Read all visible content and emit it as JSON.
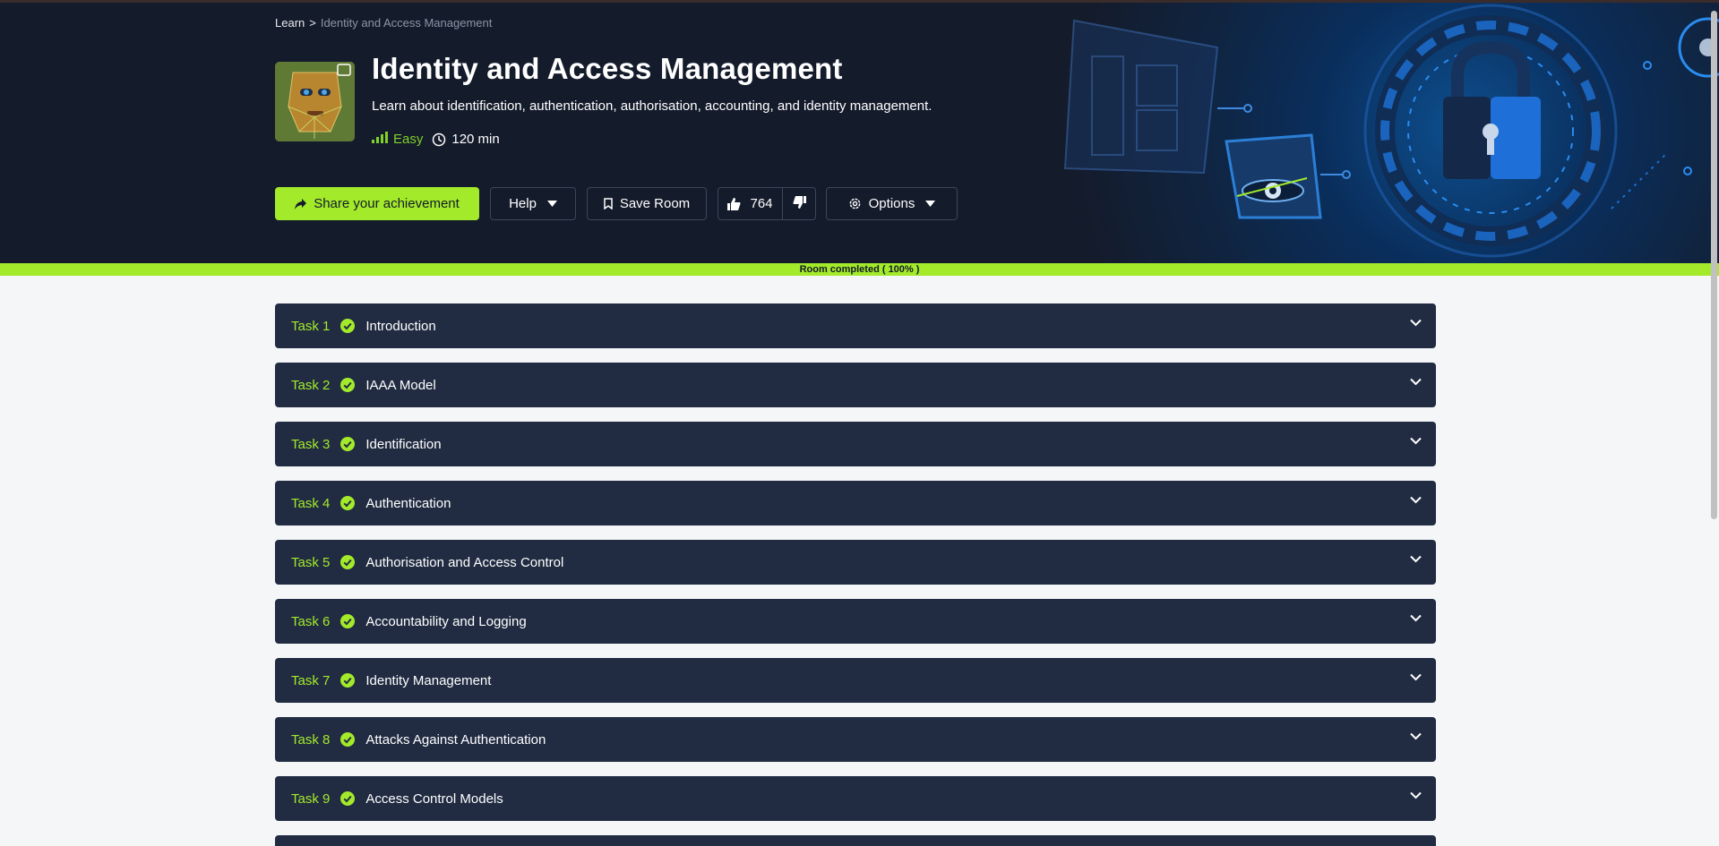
{
  "breadcrumb": {
    "root": "Learn",
    "separator": ">",
    "current": "Identity and Access Management"
  },
  "room": {
    "title": "Identity and Access Management",
    "description": "Learn about identification, authentication, authorisation, accounting, and identity management.",
    "difficulty": "Easy",
    "duration": "120 min",
    "icon": "face-scan-avatar"
  },
  "actions": {
    "share_label": "Share your achievement",
    "help_label": "Help",
    "save_label": "Save Room",
    "likes": "764",
    "options_label": "Options"
  },
  "progress": {
    "label": "Room completed ( 100% )",
    "value": 1.0
  },
  "tasks": [
    {
      "number": "Task 1",
      "title": "Introduction"
    },
    {
      "number": "Task 2",
      "title": "IAAA Model"
    },
    {
      "number": "Task 3",
      "title": "Identification"
    },
    {
      "number": "Task 4",
      "title": "Authentication"
    },
    {
      "number": "Task 5",
      "title": "Authorisation and Access Control"
    },
    {
      "number": "Task 6",
      "title": "Accountability and Logging"
    },
    {
      "number": "Task 7",
      "title": "Identity Management"
    },
    {
      "number": "Task 8",
      "title": "Attacks Against Authentication"
    },
    {
      "number": "Task 9",
      "title": "Access Control Models"
    }
  ],
  "colors": {
    "accent": "#a3ea2a",
    "hero_bg": "#141b2b",
    "task_bg": "#212c42",
    "page_bg": "#f4f6f8",
    "difficulty_easy": "#7fd02a"
  }
}
